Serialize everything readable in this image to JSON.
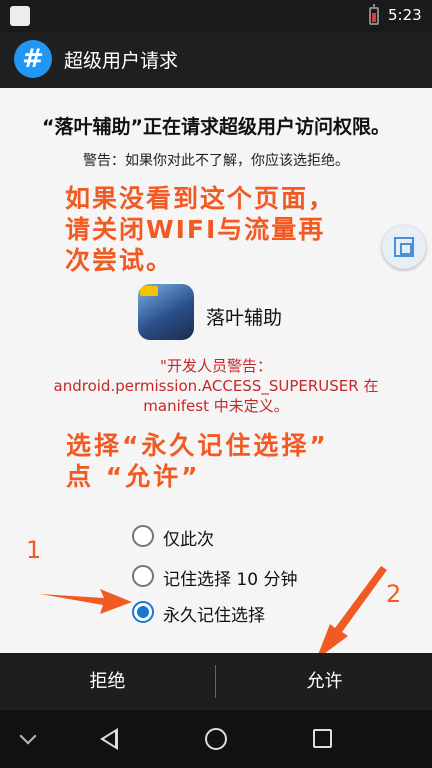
{
  "status_bar": {
    "time": "5:23"
  },
  "app_bar": {
    "icon_glyph": "#",
    "title": "超级用户请求"
  },
  "dialog": {
    "request_title": "“落叶辅助”正在请求超级用户访问权限。",
    "warning": "警告：如果你对此不了解，你应该选拒绝。",
    "app_name": "落叶辅助",
    "dev_warning": [
      "\"开发人员警告：",
      "android.permission.ACCESS_SUPERUSER 在",
      "manifest 中未定义。"
    ],
    "options": [
      {
        "label": "仅此次",
        "checked": false
      },
      {
        "label": "记住选择 10 分钟",
        "checked": false
      },
      {
        "label": "永久记住选择",
        "checked": true
      }
    ]
  },
  "overlay": {
    "hint1": [
      "如果没看到这个页面，",
      "请关闭WIFI与流量再",
      "次尝试。"
    ],
    "hint2": [
      "选择“永久记住选择”",
      "点 “允许”"
    ],
    "number1": "1",
    "number2": "2",
    "color": "#f15a22"
  },
  "buttons": {
    "deny": "拒绝",
    "allow": "允许"
  },
  "nav": {
    "icons": [
      "chevron-down-icon",
      "back-icon",
      "home-icon",
      "recents-icon"
    ]
  },
  "colors": {
    "accent": "#1976d2",
    "warning_red": "#c62828",
    "app_icon": "#2196f3"
  }
}
